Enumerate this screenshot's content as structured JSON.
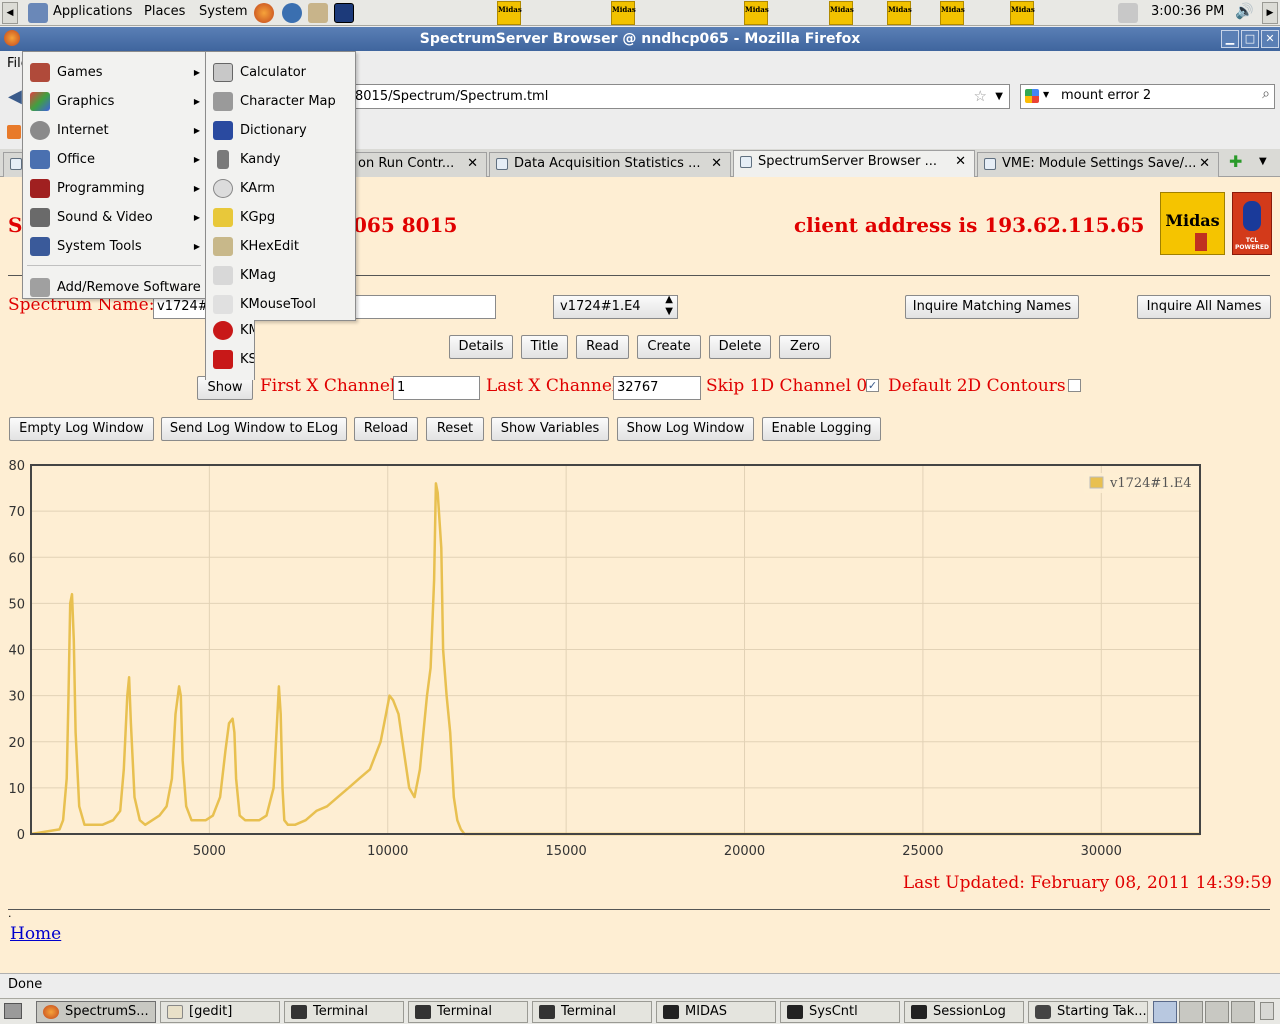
{
  "top_panel": {
    "menus": [
      "Applications",
      "Places",
      "System"
    ],
    "clock": "3:00:36 PM",
    "midas_launcher_label": "Midas"
  },
  "window": {
    "title": "SpectrumServer Browser @ nndhcp065 - Mozilla Firefox",
    "minimize": "▁",
    "maximize": "□",
    "close": "✕"
  },
  "menubar": {
    "file_fragment": "File"
  },
  "navbar": {
    "url": "8015/Spectrum/Spectrum.tml",
    "search_value": "mount error 2"
  },
  "tabs": [
    {
      "label": "on Run Contr...",
      "active": false
    },
    {
      "label": "Data Acquisition Statistics ...",
      "active": false
    },
    {
      "label": "SpectrumServer Browser ...",
      "active": true
    },
    {
      "label": "VME: Module Settings Save/...",
      "active": false
    }
  ],
  "page": {
    "header_left_fragment": "S",
    "header_host_fragment": "065 8015",
    "client_address": "client address is 193.62.115.65",
    "logo_midas": "Midas",
    "logo_tcl": "TCL POWERED",
    "spectrum_name_label": "Spectrum Name:",
    "spectrum_name_value": "v1724#",
    "spectrum_select": "v1724#1.E4",
    "inquire_matching": "Inquire Matching Names",
    "inquire_all": "Inquire All Names",
    "buttons_row": [
      "Details",
      "Title",
      "Read",
      "Create",
      "Delete",
      "Zero"
    ],
    "show_button": "Show",
    "first_x_label": "First X Channel",
    "first_x_value": "1",
    "last_x_label": "Last X Channel",
    "last_x_value": "32767",
    "skip_label": "Skip 1D Channel 0",
    "skip_checked": true,
    "default2d_label": "Default 2D Contours",
    "default2d_checked": false,
    "log_buttons": [
      "Empty Log Window",
      "Send Log Window to ELog",
      "Reload",
      "Reset",
      "Show Variables",
      "Show Log Window",
      "Enable Logging"
    ],
    "last_updated": "Last Updated: February 08, 2011 14:39:59",
    "dot": ".",
    "home_link": "Home"
  },
  "chart_data": {
    "type": "line",
    "series": [
      {
        "name": "v1724#1.E4",
        "color": "#e8c050",
        "x": [
          0,
          800,
          900,
          1000,
          1050,
          1100,
          1150,
          1200,
          1250,
          1350,
          1500,
          1700,
          2000,
          2300,
          2500,
          2600,
          2700,
          2750,
          2800,
          2900,
          3050,
          3200,
          3400,
          3600,
          3800,
          3950,
          4050,
          4150,
          4200,
          4250,
          4350,
          4500,
          4700,
          4900,
          5100,
          5300,
          5450,
          5550,
          5650,
          5700,
          5750,
          5850,
          6000,
          6200,
          6400,
          6600,
          6800,
          6900,
          6950,
          7000,
          7050,
          7100,
          7200,
          7400,
          7700,
          8000,
          8300,
          8600,
          8900,
          9200,
          9500,
          9800,
          9950,
          10050,
          10150,
          10300,
          10450,
          10600,
          10750,
          10900,
          11000,
          11100,
          11200,
          11300,
          11350,
          11400,
          11450,
          11500,
          11550,
          11650,
          11750,
          11850,
          11950,
          12050,
          12150,
          12300,
          13000,
          20000,
          30000,
          32767
        ],
        "y": [
          0,
          1,
          3,
          12,
          30,
          50,
          52,
          42,
          22,
          6,
          2,
          2,
          2,
          3,
          5,
          14,
          30,
          34,
          24,
          8,
          3,
          2,
          3,
          4,
          6,
          12,
          26,
          32,
          30,
          16,
          6,
          3,
          3,
          3,
          4,
          8,
          18,
          24,
          25,
          22,
          12,
          4,
          3,
          3,
          3,
          4,
          10,
          25,
          32,
          26,
          10,
          3,
          2,
          2,
          3,
          5,
          6,
          8,
          10,
          12,
          14,
          20,
          26,
          30,
          29,
          26,
          18,
          10,
          8,
          14,
          22,
          30,
          36,
          55,
          76,
          74,
          68,
          62,
          40,
          30,
          22,
          8,
          3,
          1,
          0,
          0,
          0,
          0,
          0,
          0
        ]
      }
    ],
    "xlim": [
      0,
      32767
    ],
    "ylim": [
      0,
      80
    ],
    "xticks": [
      5000,
      10000,
      15000,
      20000,
      25000,
      30000
    ],
    "yticks": [
      0,
      10,
      20,
      30,
      40,
      50,
      60,
      70,
      80
    ],
    "grid": true,
    "legend": "top-right"
  },
  "status_text": "Done",
  "taskbar": [
    {
      "label": "SpectrumS...",
      "active": true
    },
    {
      "label": "[gedit]",
      "active": false
    },
    {
      "label": "Terminal",
      "active": false
    },
    {
      "label": "Terminal",
      "active": false
    },
    {
      "label": "Terminal",
      "active": false
    },
    {
      "label": "MIDAS",
      "active": false
    },
    {
      "label": "SysCntl",
      "active": false
    },
    {
      "label": "SessionLog",
      "active": false
    },
    {
      "label": "Starting Tak...",
      "active": false
    }
  ],
  "menu_categories": [
    {
      "label": "Games",
      "icon": "games-icon"
    },
    {
      "label": "Graphics",
      "icon": "graphics-icon"
    },
    {
      "label": "Internet",
      "icon": "internet-icon"
    },
    {
      "label": "Office",
      "icon": "office-icon"
    },
    {
      "label": "Programming",
      "icon": "programming-icon"
    },
    {
      "label": "Sound & Video",
      "icon": "sound-video-icon"
    },
    {
      "label": "System Tools",
      "icon": "system-tools-icon"
    }
  ],
  "menu_add_remove": "Add/Remove Software",
  "menu_accessories": [
    {
      "label": "Calculator",
      "icon": "calculator-icon"
    },
    {
      "label": "Character Map",
      "icon": "character-map-icon"
    },
    {
      "label": "Dictionary",
      "icon": "dictionary-icon"
    },
    {
      "label": "Kandy",
      "icon": "kandy-icon"
    },
    {
      "label": "KArm",
      "icon": "karm-icon"
    },
    {
      "label": "KGpg",
      "icon": "kgpg-icon"
    },
    {
      "label": "KHexEdit",
      "icon": "khexedit-icon"
    },
    {
      "label": "KMag",
      "icon": "kmag-icon"
    },
    {
      "label": "KMouseTool",
      "icon": "kmousetool-icon"
    }
  ],
  "menu_accessories_tail": [
    "KM",
    "KS"
  ]
}
